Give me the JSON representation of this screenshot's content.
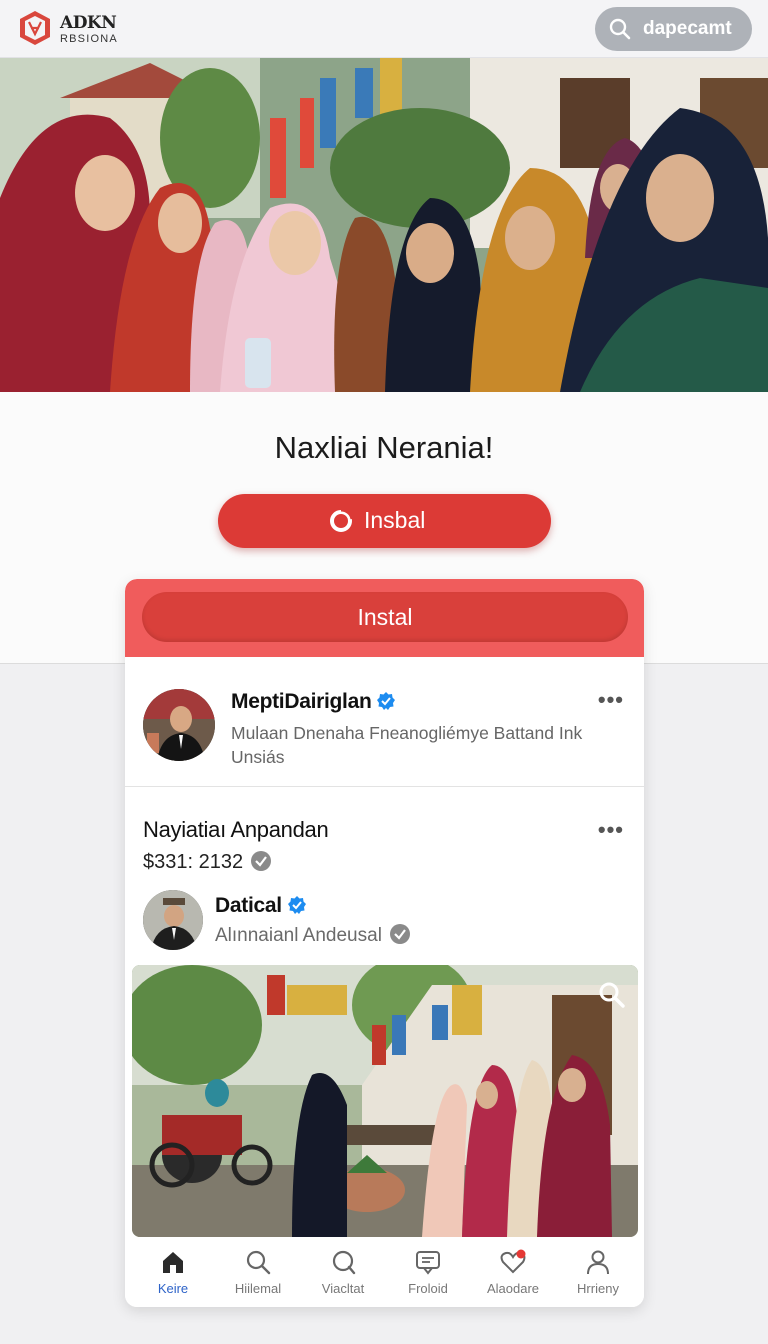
{
  "header": {
    "logo_line1": "ADKN",
    "logo_line2": "RBSIONA",
    "search_label": "dapecamt"
  },
  "hero": {
    "headline": "Naxliai Nerania!",
    "install_label": "Insbal"
  },
  "card": {
    "banner_button": "Instal",
    "post1": {
      "author": "MeptiDairiglan",
      "more": "•••",
      "description": "Mulaan Dnenaha Fneanogliémye Battand Ink Unsiás"
    },
    "post2": {
      "title": "Nayiatiaı Anpandan",
      "more": "•••",
      "price": "$331: 2132",
      "author": "Datical",
      "subtitle": "Alınnaianl Andeusal"
    }
  },
  "tabs": [
    {
      "label": "Keire",
      "icon": "home-icon",
      "active": true
    },
    {
      "label": "Hiilemal",
      "icon": "search-icon",
      "active": false
    },
    {
      "label": "Viacltat",
      "icon": "explore-icon",
      "active": false
    },
    {
      "label": "Froloid",
      "icon": "message-icon",
      "active": false
    },
    {
      "label": "Alaodare",
      "icon": "heart-icon",
      "active": false
    },
    {
      "label": "Hrrieny",
      "icon": "profile-icon",
      "active": false
    }
  ],
  "colors": {
    "accent_red": "#dc3a36",
    "banner_red": "#f05c5c",
    "active_tab": "#2e63c8",
    "verified_blue": "#1d8cf0"
  }
}
